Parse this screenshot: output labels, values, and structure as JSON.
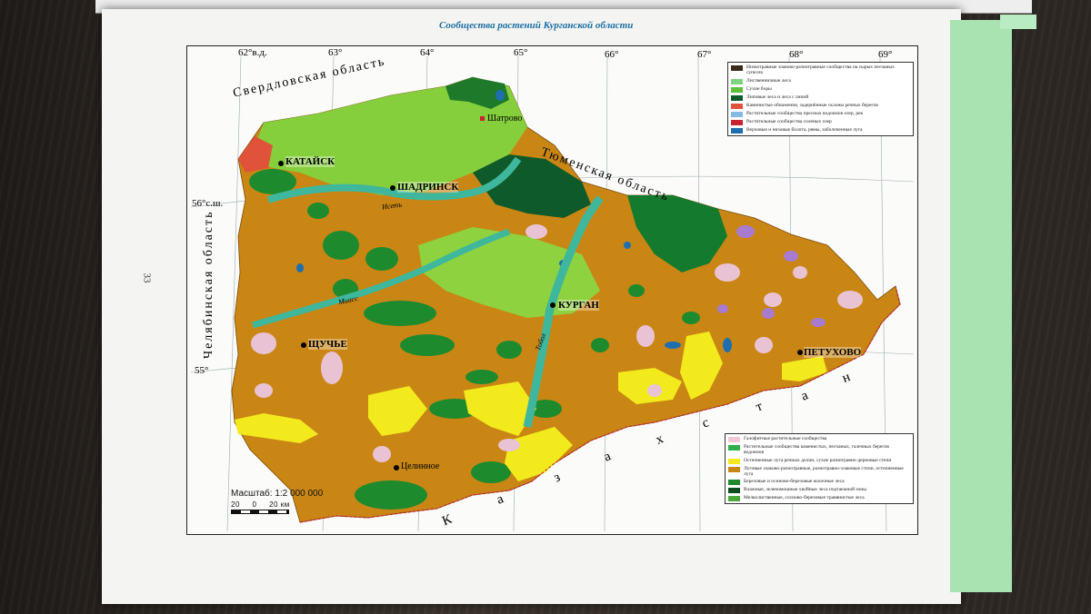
{
  "page": {
    "title": "Сообщества растений  Курганской области",
    "page_number": "33"
  },
  "longitudes": [
    "62°в.д.",
    "63°",
    "64°",
    "65°",
    "66°",
    "67°",
    "68°",
    "69°"
  ],
  "latitudes": [
    "56°с.ш.",
    "55°"
  ],
  "regions": {
    "north": "Свердловская  область",
    "east": "Тюменская  область",
    "west": "Челябинская  область",
    "south": [
      "К",
      "а",
      "з",
      "а",
      "х",
      "с",
      "т",
      "а",
      "н"
    ]
  },
  "cities": {
    "katajsk": "КАТАЙСК",
    "shadrinsk": "ШАДРИНСК",
    "shatrovo": "Шатрово",
    "kurgan": "КУРГАН",
    "shchuchye": "ЩУЧЬЕ",
    "petukhovo": "ПЕТУХОВО",
    "tselinnoe": "Целинное"
  },
  "rivers": {
    "iset": "Исеть",
    "miass": "Миасс",
    "tobol": "Тобол"
  },
  "legend_top": [
    {
      "color": "#3a2a1a",
      "text": "Низкотравные злаково-разнотравные сообщества на сырых песчаных супесях"
    },
    {
      "color": "#7fd27f",
      "text": "Лиственничные леса"
    },
    {
      "color": "#5fbe3a",
      "text": "Сухие боры"
    },
    {
      "color": "#0f5a2a",
      "text": "Липовые леса и леса с липой"
    },
    {
      "color": "#e0523a",
      "text": "Каменистые обнажения, задернённые склоны речных берегов"
    },
    {
      "color": "#86b9e6",
      "text": "Растительные сообщества пресных водоемов озер, рек"
    },
    {
      "color": "#c8232e",
      "text": "Растительные сообщества соленых озер"
    },
    {
      "color": "#1f6fb0",
      "text": "Верховые и низовые болота, рямы, заболоченные луга"
    }
  ],
  "legend_bottom": [
    {
      "color": "#f1c8d6",
      "text": "Галофитные растительные сообщества"
    },
    {
      "color": "#2fb04a",
      "text": "Растительные сообщества каменистых, песчаных, галечных берегов водоемов"
    },
    {
      "color": "#f2ea1d",
      "text": "Остепненные луга речных долин, сухие разнотравно-дерновые степи"
    },
    {
      "color": "#c98614",
      "text": "Луговые злаково-разнотравные, разнотравно-злаковые степи, остепненные луга"
    },
    {
      "color": "#1e8a2e",
      "text": "Березовые и осиново-березовые колочные леса"
    },
    {
      "color": "#0b4d1f",
      "text": "Влажные, зеленомошные хвойные леса подтаежной зоны"
    },
    {
      "color": "#4aa83a",
      "text": "Мелколиственные, сосново-березовые травянистые леса"
    }
  ],
  "scale": {
    "label": "Масштаб: 1:2 000 000",
    "ticks": "20     0     20 км"
  },
  "colors": {
    "steppe": "#c98614",
    "forest": "#1e8a2e",
    "light_forest": "#7fcf3a",
    "river": "#3fb79c",
    "yellow": "#f2ea1d",
    "halophyte": "#e9c3d3"
  }
}
